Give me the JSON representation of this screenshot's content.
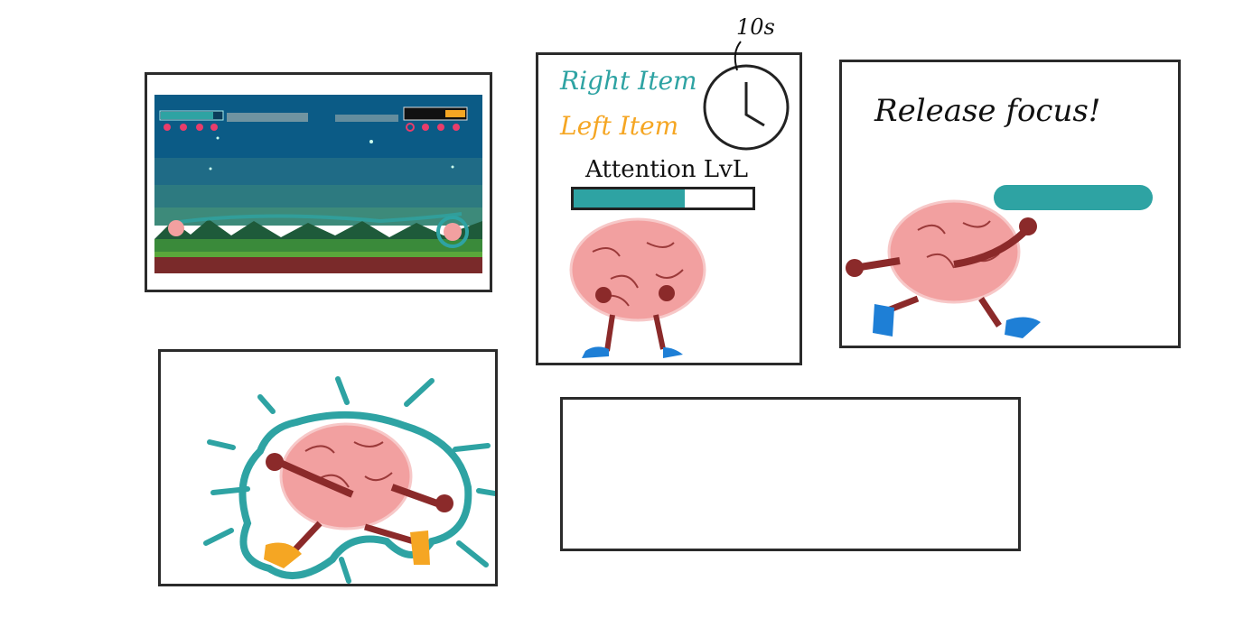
{
  "storyboard": {
    "panel_game": {
      "description_visible": false
    },
    "panel_hud": {
      "right_item_label": "Right Item",
      "left_item_label": "Left Item",
      "attention_label": "Attention LvL",
      "timer_label": "10s",
      "attention_level": 0.62
    },
    "panel_release": {
      "message": "Release focus!"
    },
    "colors": {
      "teal": "#2ea3a3",
      "orange": "#f5a623",
      "brain_pink": "#f2a0a0",
      "limb": "#8b2a2a",
      "shoe_blue": "#1e7fd6",
      "shoe_orange": "#f5a623",
      "sky": "#0b5b86",
      "ground": "#7a2a2a"
    }
  }
}
